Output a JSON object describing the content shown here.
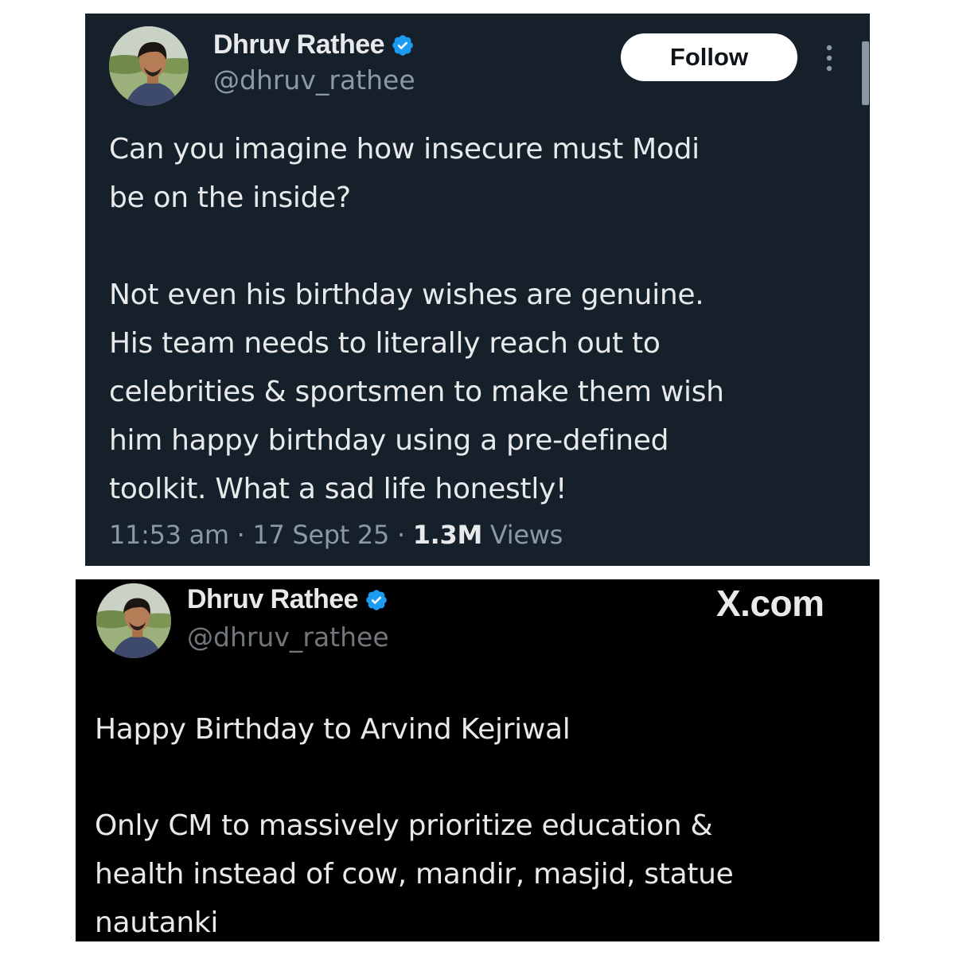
{
  "tweet_top": {
    "author": {
      "name": "Dhruv Rathee",
      "handle": "@dhruv_rathee",
      "verified": true
    },
    "follow_label": "Follow",
    "text_lines_para1": [
      "Can you imagine how insecure must Modi",
      "be on the inside?"
    ],
    "text_lines_para2": [
      "Not even his birthday wishes are genuine.",
      "His team needs to literally reach out to",
      "celebrities & sportsmen to make them wish",
      "him happy birthday using a pre-defined",
      "toolkit. What a sad life honestly!"
    ],
    "meta": {
      "time": "11:53 am",
      "separator": "·",
      "date": "17 Sept 25",
      "views_count": "1.3M",
      "views_label": "Views"
    }
  },
  "tweet_bottom": {
    "author": {
      "name": "Dhruv Rathee",
      "handle": "@dhruv_rathee",
      "verified": true
    },
    "source_label": "X.com",
    "text_lines_para1": [
      "Happy Birthday to Arvind Kejriwal"
    ],
    "text_lines_para2": [
      "Only CM to massively prioritize education &",
      "health instead of cow, mandir, masjid, statue",
      "nautanki"
    ]
  },
  "colors": {
    "dim_background": "#15202b",
    "black_background": "#000000",
    "verified_blue": "#1d9bf0",
    "primary_text": "#e7e9ea",
    "secondary_text": "#8b98a5"
  }
}
